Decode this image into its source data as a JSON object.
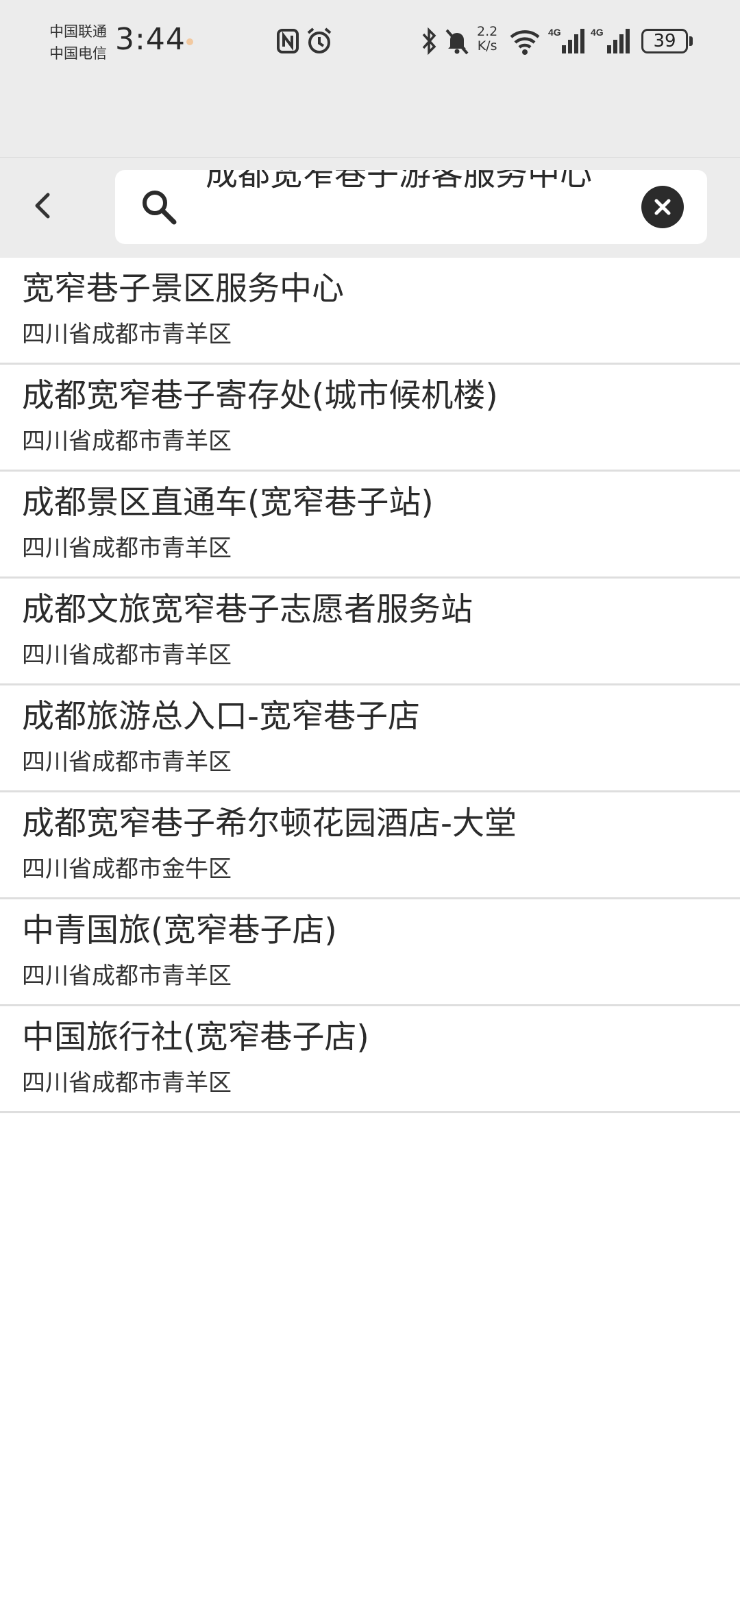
{
  "status_bar": {
    "carrier_1": "中国联通",
    "carrier_2": "中国电信",
    "time": "3:44",
    "net_speed_value": "2.2",
    "net_speed_unit": "K/s",
    "signal_1_label": "4G",
    "signal_2_label": "4G",
    "battery": "39",
    "icons": [
      "nfc-icon",
      "alarm-icon",
      "bluetooth-icon",
      "mute-icon",
      "wifi-icon",
      "signal-icon",
      "battery-icon"
    ]
  },
  "search": {
    "query": "成都宽窄巷子游客服务中心",
    "back_icon": "back-arrow-icon",
    "search_icon": "search-icon",
    "clear_icon": "clear-icon"
  },
  "results": [
    {
      "title": "宽窄巷子景区服务中心",
      "address": "四川省成都市青羊区"
    },
    {
      "title": "成都宽窄巷子寄存处(城市候机楼)",
      "address": "四川省成都市青羊区"
    },
    {
      "title": "成都景区直通车(宽窄巷子站)",
      "address": "四川省成都市青羊区"
    },
    {
      "title": "成都文旅宽窄巷子志愿者服务站",
      "address": "四川省成都市青羊区"
    },
    {
      "title": "成都旅游总入口-宽窄巷子店",
      "address": "四川省成都市青羊区"
    },
    {
      "title": "成都宽窄巷子希尔顿花园酒店-大堂",
      "address": "四川省成都市金牛区"
    },
    {
      "title": "中青国旅(宽窄巷子店)",
      "address": "四川省成都市青羊区"
    },
    {
      "title": "中国旅行社(宽窄巷子店)",
      "address": "四川省成都市青羊区"
    }
  ]
}
